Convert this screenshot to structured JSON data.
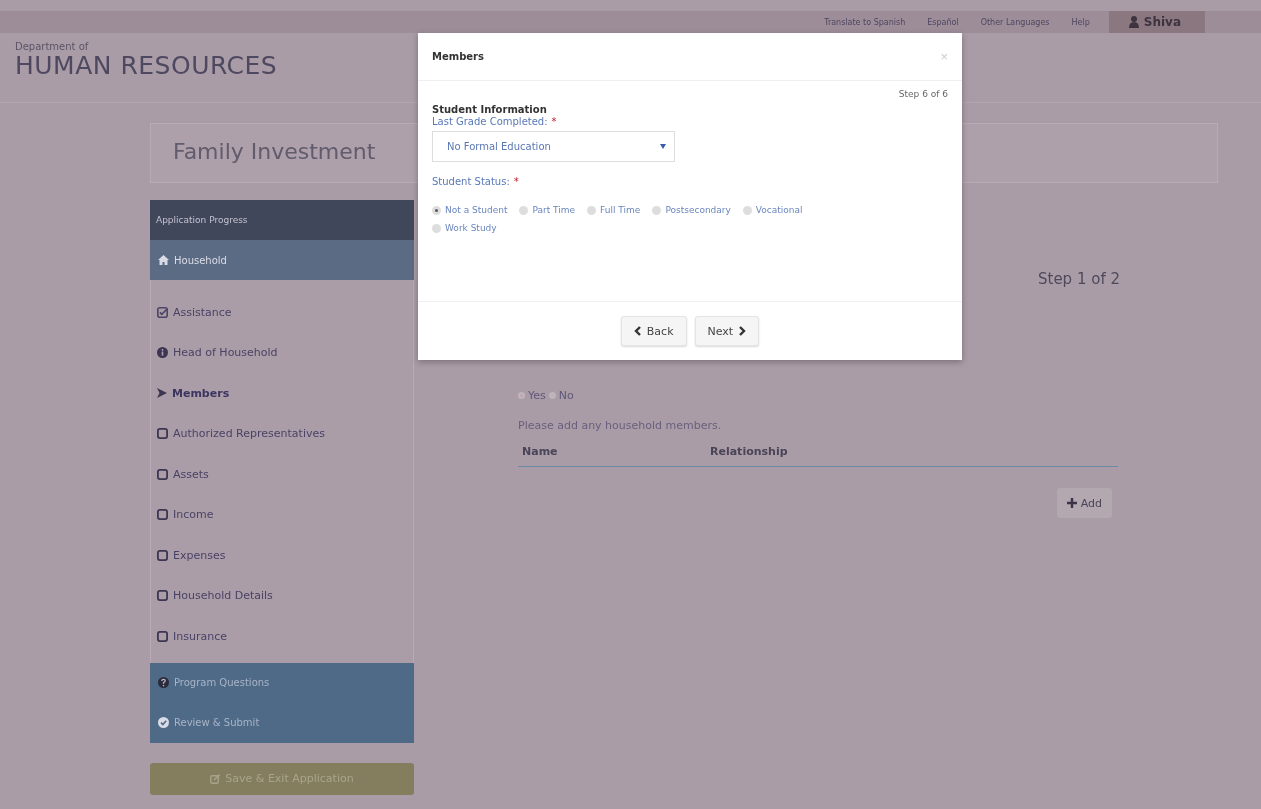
{
  "top_nav": {
    "links": [
      "Translate to Spanish",
      "Español",
      "Other Languages",
      "Help"
    ],
    "user": "Shiva"
  },
  "header": {
    "department": "Department of",
    "title": "HUMAN RESOURCES"
  },
  "page_title": "Family Investment",
  "sidebar": {
    "heading": "Application Progress",
    "items": [
      {
        "kind": "section",
        "label": "Household",
        "selected": true
      },
      {
        "kind": "complete",
        "label": "Assistance"
      },
      {
        "kind": "started",
        "label": "Head of Household"
      },
      {
        "kind": "current",
        "label": "Members"
      },
      {
        "kind": "pending",
        "label": "Authorized Representatives"
      },
      {
        "kind": "pending",
        "label": "Assets"
      },
      {
        "kind": "pending",
        "label": "Income"
      },
      {
        "kind": "pending",
        "label": "Expenses"
      },
      {
        "kind": "pending",
        "label": "Household Details"
      },
      {
        "kind": "pending",
        "label": "Insurance"
      },
      {
        "kind": "section",
        "label": "Program Questions",
        "selected": false
      },
      {
        "kind": "section",
        "label": "Review & Submit",
        "selected": false
      }
    ],
    "save_button": "Save & Exit Application"
  },
  "main": {
    "step": "Step 1 of 2",
    "answers": [
      {
        "label": "Yes",
        "selected": true
      },
      {
        "label": "No",
        "selected": false
      }
    ],
    "instruction": "Please add any household members.",
    "table": {
      "columns": [
        "Name",
        "Relationship"
      ]
    },
    "add_button": "Add"
  },
  "modal": {
    "title": "Members",
    "close": "×",
    "step": "Step 6 of 6",
    "section": "Student Information",
    "grade": {
      "label": "Last Grade Completed:",
      "required_mark": "*",
      "value": "No Formal Education"
    },
    "status": {
      "label": "Student Status:",
      "required_mark": "*",
      "options": [
        {
          "label": "Not a Student",
          "selected": true
        },
        {
          "label": "Part Time",
          "selected": false
        },
        {
          "label": "Full Time",
          "selected": false
        },
        {
          "label": "Postsecondary",
          "selected": false
        },
        {
          "label": "Vocational",
          "selected": false
        },
        {
          "label": "Work Study",
          "selected": false
        }
      ]
    },
    "buttons": {
      "back": "Back",
      "next": "Next"
    }
  }
}
